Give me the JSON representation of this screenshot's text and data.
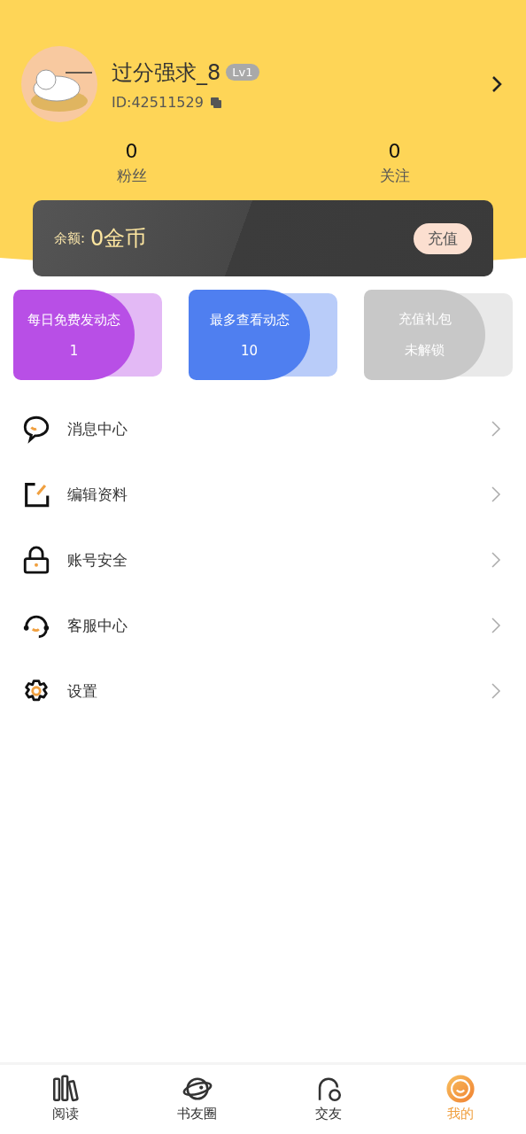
{
  "profile": {
    "name": "过分强求_8",
    "level_badge": "Lv1",
    "id_text": "ID:42511529"
  },
  "stats": [
    {
      "value": "0",
      "label": "粉丝"
    },
    {
      "value": "0",
      "label": "关注"
    }
  ],
  "balance": {
    "label": "余额:",
    "amount": "0金币",
    "button": "充值"
  },
  "cards": [
    {
      "title": "每日免费发动态",
      "value": "1",
      "color": "#b84fe6"
    },
    {
      "title": "最多查看动态",
      "value": "10",
      "color": "#4f7ff0"
    },
    {
      "title": "充值礼包",
      "value": "未解锁",
      "color": "#c8c8c8"
    }
  ],
  "menu": [
    {
      "label": "消息中心"
    },
    {
      "label": "编辑资料"
    },
    {
      "label": "账号安全"
    },
    {
      "label": "客服中心"
    },
    {
      "label": "设置"
    }
  ],
  "tabs": [
    {
      "label": "阅读",
      "selected": false
    },
    {
      "label": "书友圈",
      "selected": false
    },
    {
      "label": "交友",
      "selected": false
    },
    {
      "label": "我的",
      "selected": true
    }
  ]
}
